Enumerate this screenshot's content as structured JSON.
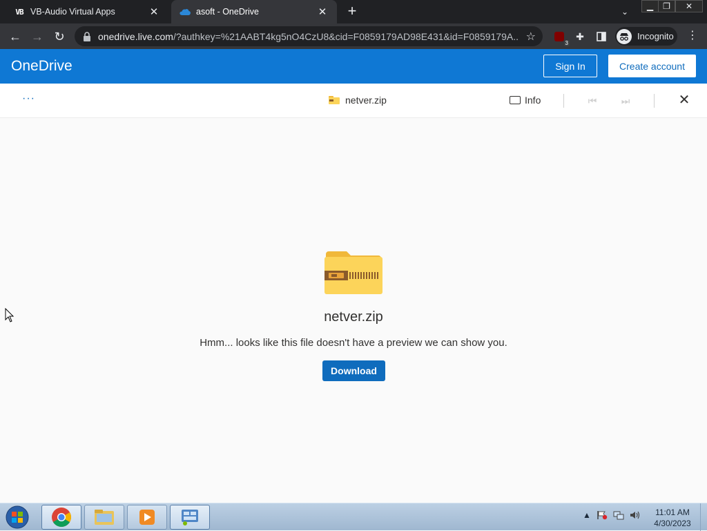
{
  "browser": {
    "tabs": [
      {
        "title": "VB-Audio Virtual Apps",
        "favicon": "vb-audio-icon",
        "active": false
      },
      {
        "title": "asoft - OneDrive",
        "favicon": "onedrive-cloud-icon",
        "active": true
      }
    ],
    "new_tab": "+",
    "url": {
      "host": "onedrive.live.com",
      "rest": "/?authkey=%21AABT4kg5nO4CzU8&cid=F0859179AD98E431&id=F0859179A..."
    },
    "extension_badge": "3",
    "incognito_label": "Incognito"
  },
  "onedrive": {
    "brand": "OneDrive",
    "sign_in": "Sign In",
    "create_account": "Create account",
    "command_bar": {
      "more": "···",
      "file_name": "netver.zip",
      "info": "Info"
    },
    "preview": {
      "file_name": "netver.zip",
      "message": "Hmm... looks like this file doesn't have a preview we can show you.",
      "download": "Download"
    },
    "colors": {
      "brand_blue": "#0f78d4",
      "button_blue": "#0f6cbd",
      "zip_yellow": "#fcd45a"
    }
  },
  "taskbar": {
    "apps": [
      "chrome-icon",
      "file-explorer-icon",
      "media-player-icon",
      "control-panel-icon"
    ],
    "clock": {
      "time": "11:01 AM",
      "date": "4/30/2023"
    }
  }
}
